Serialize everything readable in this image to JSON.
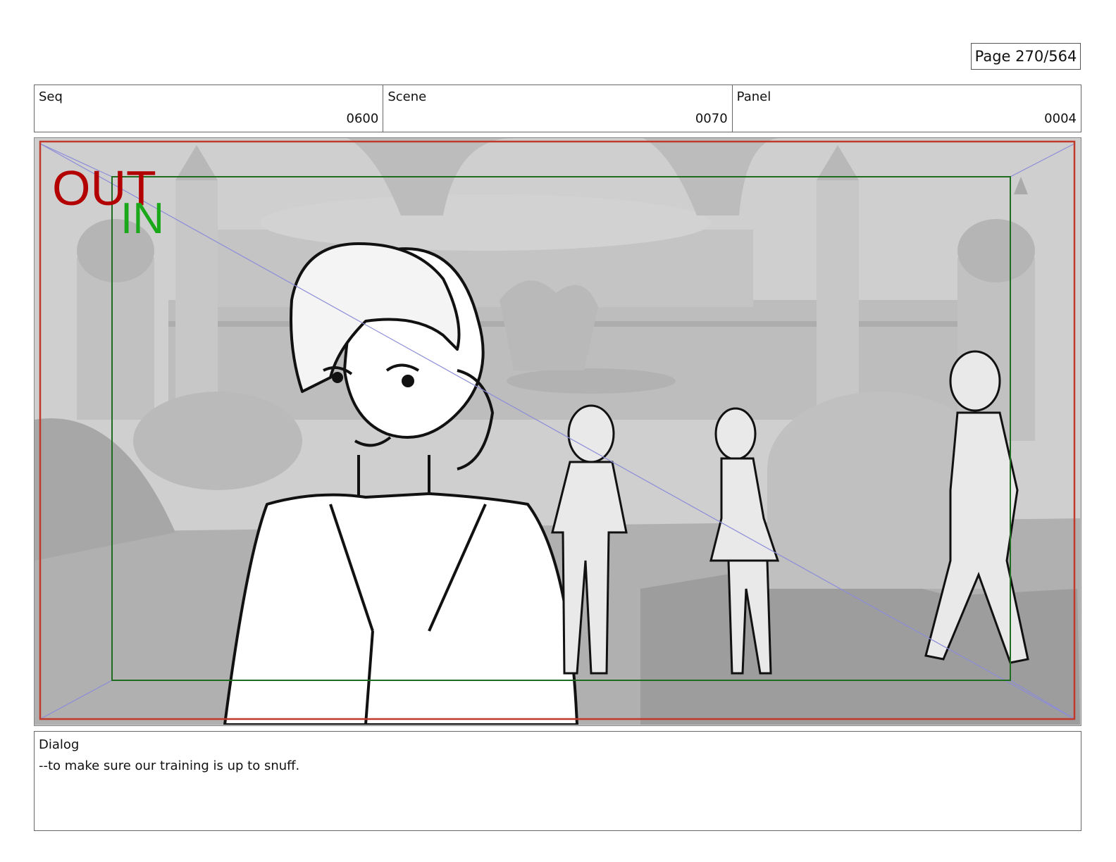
{
  "page": {
    "label": "Page 270/564"
  },
  "meta": {
    "seq": {
      "label": "Seq",
      "value": "0600"
    },
    "scene": {
      "label": "Scene",
      "value": "0070"
    },
    "panel": {
      "label": "Panel",
      "value": "0004"
    }
  },
  "frame": {
    "out_marker": "OUT",
    "in_marker": "IN",
    "colors": {
      "out": "#b30000",
      "in": "#1aa81a",
      "outer_frame": "#c0392b",
      "safe_frame": "#1f6b1f",
      "guides": "#8c8cd9"
    }
  },
  "dialog": {
    "label": "Dialog",
    "text": "--to make sure our training is up to snuff."
  }
}
